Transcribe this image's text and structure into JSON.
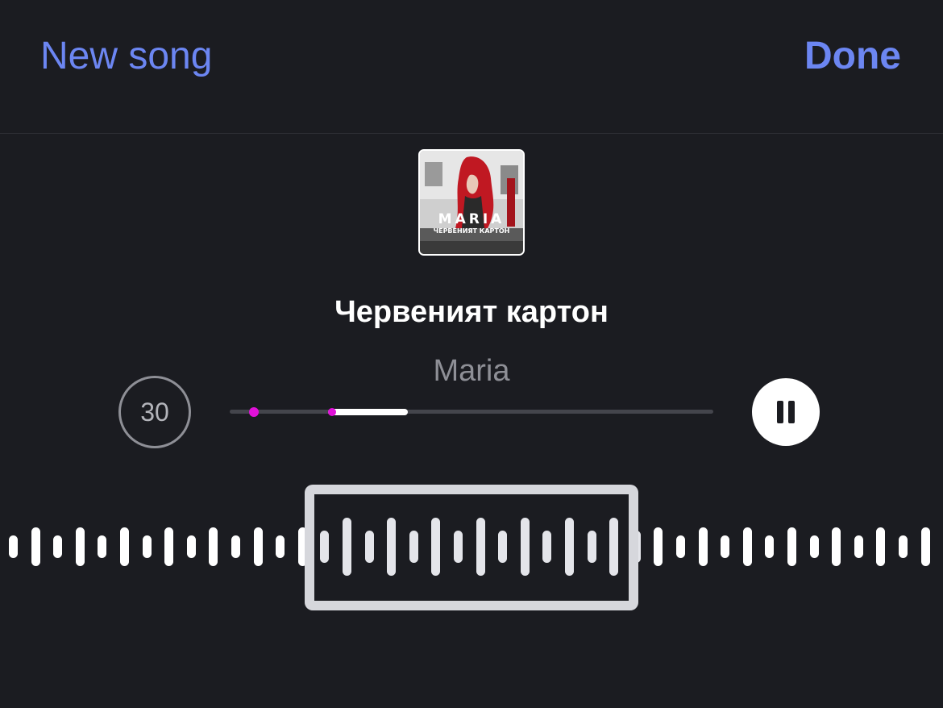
{
  "header": {
    "left_label": "New song",
    "right_label": "Done"
  },
  "album": {
    "cover_artist_text": "MARIA",
    "cover_title_text": "ЧЕРВЕНИЯТ КАРТОН"
  },
  "song": {
    "title": "Червеният картон",
    "artist": "Maria"
  },
  "controls": {
    "skip_label": "30",
    "state": "playing"
  },
  "colors": {
    "accent": "#6c86f2",
    "background": "#1b1c21",
    "marker": "#e011d8"
  },
  "icons": {
    "skip": "skip-30-icon",
    "pause": "pause-icon"
  }
}
